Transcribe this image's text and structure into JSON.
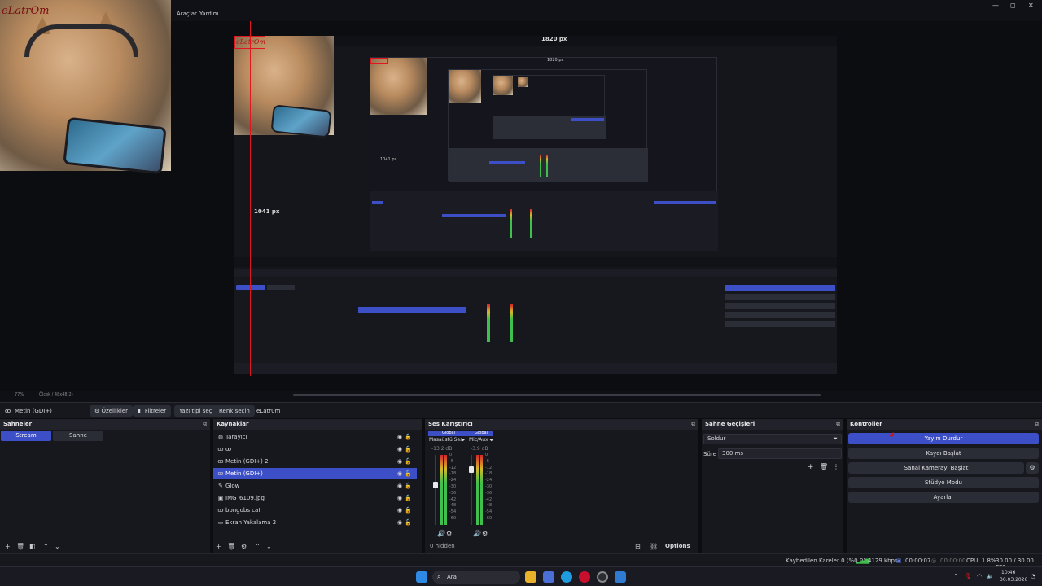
{
  "menu": {
    "tools": "Araçlar",
    "help": "Yardım"
  },
  "window": {
    "minimize": "—",
    "maximize": "◻",
    "close": "✕"
  },
  "webcam_overlay": {
    "label": "eLatrOm"
  },
  "preview": {
    "width_label": "1820 px",
    "height_label": "1041 px",
    "nested_width_label": "1820 px",
    "nested_height_label": "1041 px",
    "nested_label": "eLatrOm",
    "zoom": "77%",
    "zoom_mode": "Ölçek / 48x48(2)"
  },
  "toolbar": {
    "source_name": "Metin (GDI+)",
    "properties": "Özellikler",
    "filters": "Filtreler",
    "font": "Yazı tipi seç",
    "color": "Renk seçin",
    "text_value": "eLatr0m"
  },
  "scenes": {
    "title": "Sahneler",
    "items": [
      {
        "label": "Stream",
        "active": true
      },
      {
        "label": "Sahne",
        "active": false
      }
    ]
  },
  "sources": {
    "title": "Kaynaklar",
    "items": [
      {
        "icon": "globe",
        "glyph": "◍",
        "label": "Tarayıcı",
        "selected": false
      },
      {
        "icon": "group",
        "glyph": "ꝏ",
        "label": "ꝏ",
        "selected": false
      },
      {
        "icon": "text",
        "glyph": "ꝏ",
        "label": "Metin (GDI+) 2",
        "selected": false
      },
      {
        "icon": "text",
        "glyph": "ꝏ",
        "label": "Metin (GDI+)",
        "selected": true
      },
      {
        "icon": "brush",
        "glyph": "✎",
        "label": "Glow",
        "selected": false
      },
      {
        "icon": "image",
        "glyph": "▣",
        "label": "IMG_6109.jpg",
        "selected": false
      },
      {
        "icon": "group",
        "glyph": "ꝏ",
        "label": "bongobs cat",
        "selected": false
      },
      {
        "icon": "monitor",
        "glyph": "▭",
        "label": "Ekran Yakalama 2",
        "selected": false
      }
    ]
  },
  "mixer": {
    "title": "Ses Karıştırıcı",
    "channels": [
      {
        "tag": "Global",
        "name": "Masaüstü Ses",
        "db": "-13.2 dB"
      },
      {
        "tag": "Global",
        "name": "Mic/Aux",
        "db": "-3.9 dB"
      }
    ],
    "scale": [
      "0",
      "-6",
      "-12",
      "-18",
      "-24",
      "-30",
      "-36",
      "-42",
      "-48",
      "-54",
      "-60"
    ],
    "hidden": "0 hidden",
    "options": "Options"
  },
  "transitions": {
    "title": "Sahne Geçişleri",
    "type": "Soldur",
    "duration_label": "Süre",
    "duration_value": "300 ms"
  },
  "controls": {
    "title": "Kontroller",
    "stop_stream": "Yayını Durdur",
    "start_record": "Kaydı Başlat",
    "virtual_cam": "Sanal Kamerayı Başlat",
    "studio_mode": "Stüdyo Modu",
    "settings": "Ayarlar"
  },
  "status": {
    "dropped": "Kaybedilen Kareler 0 (%0.0)",
    "bitrate": "4129 kbps",
    "stream_time": "00:00:07",
    "record_time": "00:00:00",
    "cpu": "CPU: 1.8%",
    "fps": "30.00 / 30.00 FPS"
  },
  "taskbar": {
    "search": "Ara",
    "time": "10:46",
    "date": "30.03.2026"
  },
  "colors": {
    "accent": "#3d4fc7",
    "record_red": "#e0171e",
    "meter_green": "#3fbf4b"
  }
}
